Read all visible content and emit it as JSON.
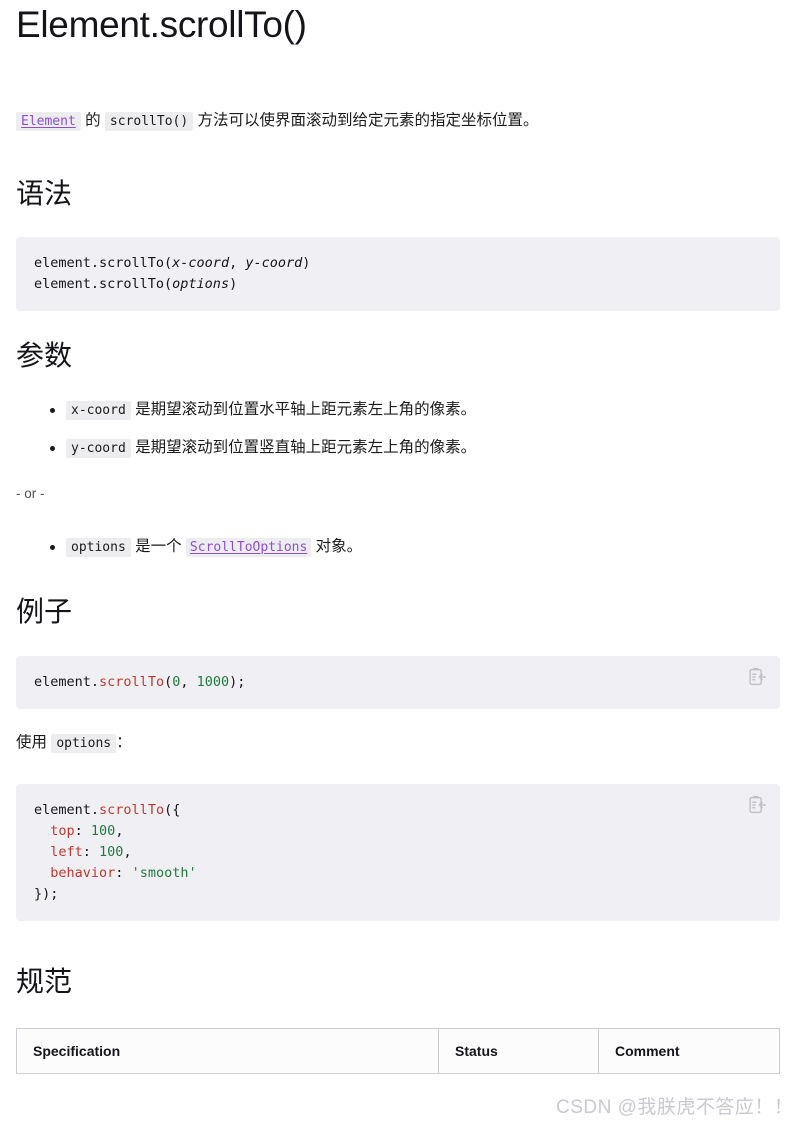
{
  "page": {
    "title": "Element.scrollTo()",
    "intro": {
      "link_text": "Element",
      "mid_text": " 的 ",
      "code_text": "scrollTo()",
      "tail_text": " 方法可以使界面滚动到给定元素的指定坐标位置。"
    }
  },
  "sections": {
    "syntax": {
      "heading": "语法",
      "code": {
        "line1_prefix": "element.scrollTo(",
        "line1_arg1": "x-coord",
        "line1_sep": ", ",
        "line1_arg2": "y-coord",
        "line1_suffix": ")",
        "line2_prefix": "element.scrollTo(",
        "line2_arg": "options",
        "line2_suffix": ")"
      }
    },
    "parameters": {
      "heading": "参数",
      "items": [
        {
          "code": "x-coord",
          "text": " 是期望滚动到位置水平轴上距元素左上角的像素。"
        },
        {
          "code": "y-coord",
          "text": " 是期望滚动到位置竖直轴上距元素左上角的像素。"
        }
      ],
      "or_separator": "- or -",
      "options_item": {
        "code": "options",
        "text_before": " 是一个 ",
        "link_text": "ScrollToOptions",
        "text_after": " 对象。"
      }
    },
    "examples": {
      "heading": "例子",
      "code1": {
        "obj": "element",
        "dot": ".",
        "fn": "scrollTo",
        "open": "(",
        "num1": "0",
        "comma": ", ",
        "num2": "1000",
        "close": ");"
      },
      "usage_label_before": "使用 ",
      "usage_code": "options",
      "usage_label_after": "：",
      "code2": {
        "l1_obj": "element",
        "l1_dot": ".",
        "l1_fn": "scrollTo",
        "l1_open": "({",
        "l2_key": "top",
        "l2_colon": ": ",
        "l2_val": "100",
        "l2_comma": ",",
        "l3_key": "left",
        "l3_colon": ": ",
        "l3_val": "100",
        "l3_comma": ",",
        "l4_key": "behavior",
        "l4_colon": ": ",
        "l4_val": "'smooth'",
        "l5_close": "});"
      }
    },
    "specifications": {
      "heading": "规范",
      "table": {
        "columns": [
          "Specification",
          "Status",
          "Comment"
        ]
      }
    }
  },
  "overlay": {
    "watermark": "CSDN @我朕虎不答应！！"
  },
  "icons": {
    "copy": "copy-to-clipboard-icon"
  },
  "colors": {
    "link": "#8a4fd3",
    "code_bg": "#f0f0f4",
    "chip_bg": "#ededf0",
    "keyword": "#c0392b",
    "number": "#1f7a3d",
    "string": "#1f7a3d",
    "text": "#1b1b1b",
    "watermark": "#c9c9cf"
  }
}
